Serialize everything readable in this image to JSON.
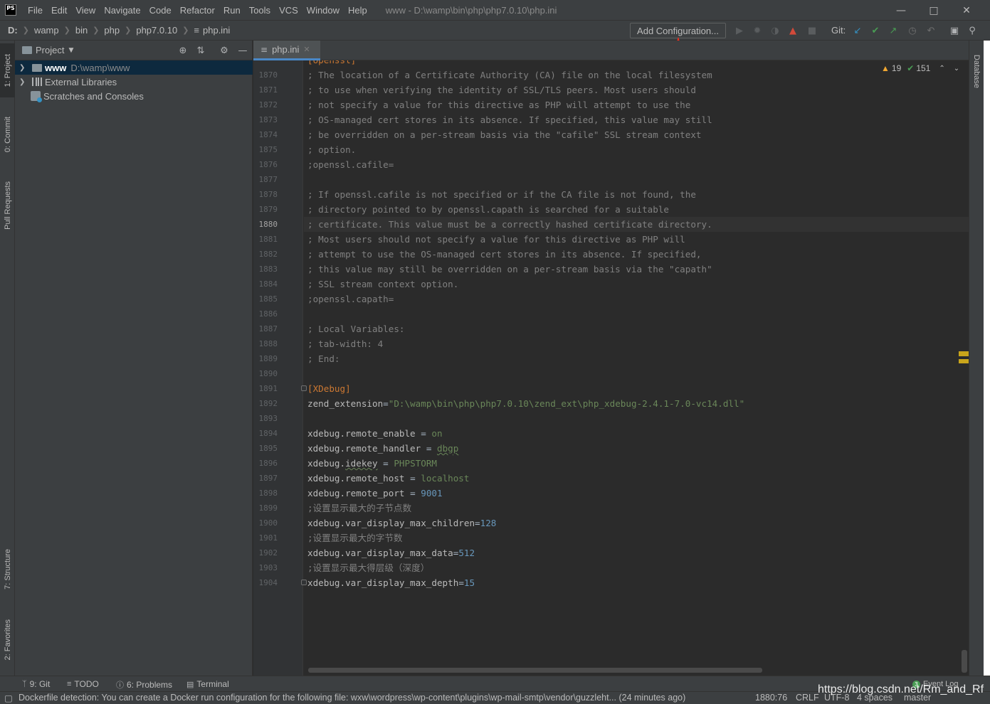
{
  "titlebar": {
    "app_logo": "PS",
    "menu": [
      "File",
      "Edit",
      "View",
      "Navigate",
      "Code",
      "Refactor",
      "Run",
      "Tools",
      "VCS",
      "Window",
      "Help"
    ],
    "window_title": "www - D:\\wamp\\bin\\php\\php7.0.10\\php.ini"
  },
  "navbar": {
    "breadcrumbs": [
      "D:",
      "wamp",
      "bin",
      "php",
      "php7.0.10",
      "php.ini"
    ],
    "add_configuration": "Add Configuration...",
    "git_label": "Git:"
  },
  "left_tabs": [
    "1: Project",
    "0: Commit",
    "Pull Requests",
    "7: Structure",
    "2: Favorites"
  ],
  "right_tabs": [
    "Database"
  ],
  "project": {
    "title": "Project",
    "tree": [
      {
        "name": "www",
        "path": "D:\\wamp\\www"
      },
      {
        "name": "External Libraries"
      },
      {
        "name": "Scratches and Consoles"
      }
    ]
  },
  "editor": {
    "tab": "php.ini",
    "first_partial": "[openssl]",
    "current_line": "1880",
    "inspections": {
      "warnings": "19",
      "ok": "151"
    },
    "lines": [
      {
        "n": "1870",
        "t": "; The location of a Certificate Authority (CA) file on the local filesystem"
      },
      {
        "n": "1871",
        "t": "; to use when verifying the identity of SSL/TLS peers. Most users should"
      },
      {
        "n": "1872",
        "t": "; not specify a value for this directive as PHP will attempt to use the"
      },
      {
        "n": "1873",
        "t": "; OS-managed cert stores in its absence. If specified, this value may still"
      },
      {
        "n": "1874",
        "t": "; be overridden on a per-stream basis via the \"cafile\" SSL stream context"
      },
      {
        "n": "1875",
        "t": "; option."
      },
      {
        "n": "1876",
        "t": ";openssl.cafile="
      },
      {
        "n": "1877",
        "t": ""
      },
      {
        "n": "1878",
        "t": "; If openssl.cafile is not specified or if the CA file is not found, the"
      },
      {
        "n": "1879",
        "t": "; directory pointed to by openssl.capath is searched for a suitable"
      },
      {
        "n": "1880",
        "t": "; certificate. This value must be a correctly hashed certificate directory."
      },
      {
        "n": "1881",
        "t": "; Most users should not specify a value for this directive as PHP will"
      },
      {
        "n": "1882",
        "t": "; attempt to use the OS-managed cert stores in its absence. If specified,"
      },
      {
        "n": "1883",
        "t": "; this value may still be overridden on a per-stream basis via the \"capath\""
      },
      {
        "n": "1884",
        "t": "; SSL stream context option."
      },
      {
        "n": "1885",
        "t": ";openssl.capath="
      },
      {
        "n": "1886",
        "t": ""
      },
      {
        "n": "1887",
        "t": "; Local Variables:"
      },
      {
        "n": "1888",
        "t": "; tab-width: 4"
      },
      {
        "n": "1889",
        "t": "; End:"
      },
      {
        "n": "1890",
        "t": ""
      },
      {
        "n": "1891",
        "section": "[XDebug]"
      },
      {
        "n": "1892",
        "k": "zend_extension",
        "eq": "=",
        "v": "\"D:\\wamp\\bin\\php\\php7.0.10\\zend_ext\\php_xdebug-2.4.1-7.0-vc14.dll\"",
        "vt": "str"
      },
      {
        "n": "1893",
        "t": ""
      },
      {
        "n": "1894",
        "k": "xdebug.remote_enable",
        "eq": " = ",
        "v": "on",
        "vt": "str"
      },
      {
        "n": "1895",
        "k": "xdebug.remote_handler",
        "eq": " = ",
        "v": "dbgp",
        "vt": "str"
      },
      {
        "n": "1896",
        "k": "xdebug.idekey",
        "eq": " = ",
        "v": "PHPSTORM",
        "vt": "str"
      },
      {
        "n": "1897",
        "k": "xdebug.remote_host",
        "eq": " = ",
        "v": "localhost",
        "vt": "str"
      },
      {
        "n": "1898",
        "k": "xdebug.remote_port",
        "eq": " = ",
        "v": "9001",
        "vt": "num"
      },
      {
        "n": "1899",
        "t": ";设置显示最大的子节点数"
      },
      {
        "n": "1900",
        "k": "xdebug.var_display_max_children",
        "eq": "=",
        "v": "128",
        "vt": "num"
      },
      {
        "n": "1901",
        "t": ";设置显示最大的字节数"
      },
      {
        "n": "1902",
        "k": "xdebug.var_display_max_data",
        "eq": "=",
        "v": "512",
        "vt": "num"
      },
      {
        "n": "1903",
        "t": ";设置显示最大得层级（深度）"
      },
      {
        "n": "1904",
        "k": "xdebug.var_display_max_depth",
        "eq": "=",
        "v": "15",
        "vt": "num"
      }
    ]
  },
  "bottom_tools": [
    "9: Git",
    "TODO",
    "6: Problems",
    "Terminal",
    "Event Log"
  ],
  "event_log_count": "3",
  "status": {
    "message": "Dockerfile detection: You can create a Docker run configuration for the following file: wxw\\wordpress\\wp-content\\plugins\\wp-mail-smtp\\vendor\\guzzleht... (24 minutes ago)",
    "position": "1880:76",
    "line_sep": "CRLF",
    "encoding": "UTF-8",
    "indent": "4 spaces",
    "branch": "master"
  },
  "watermark": "https://blog.csdn.net/Rm_and_Rf",
  "colors": {
    "accent": "#4a88c7",
    "annotation": "#ff2a1a",
    "warning": "#f0a732",
    "ok": "#499c54"
  }
}
